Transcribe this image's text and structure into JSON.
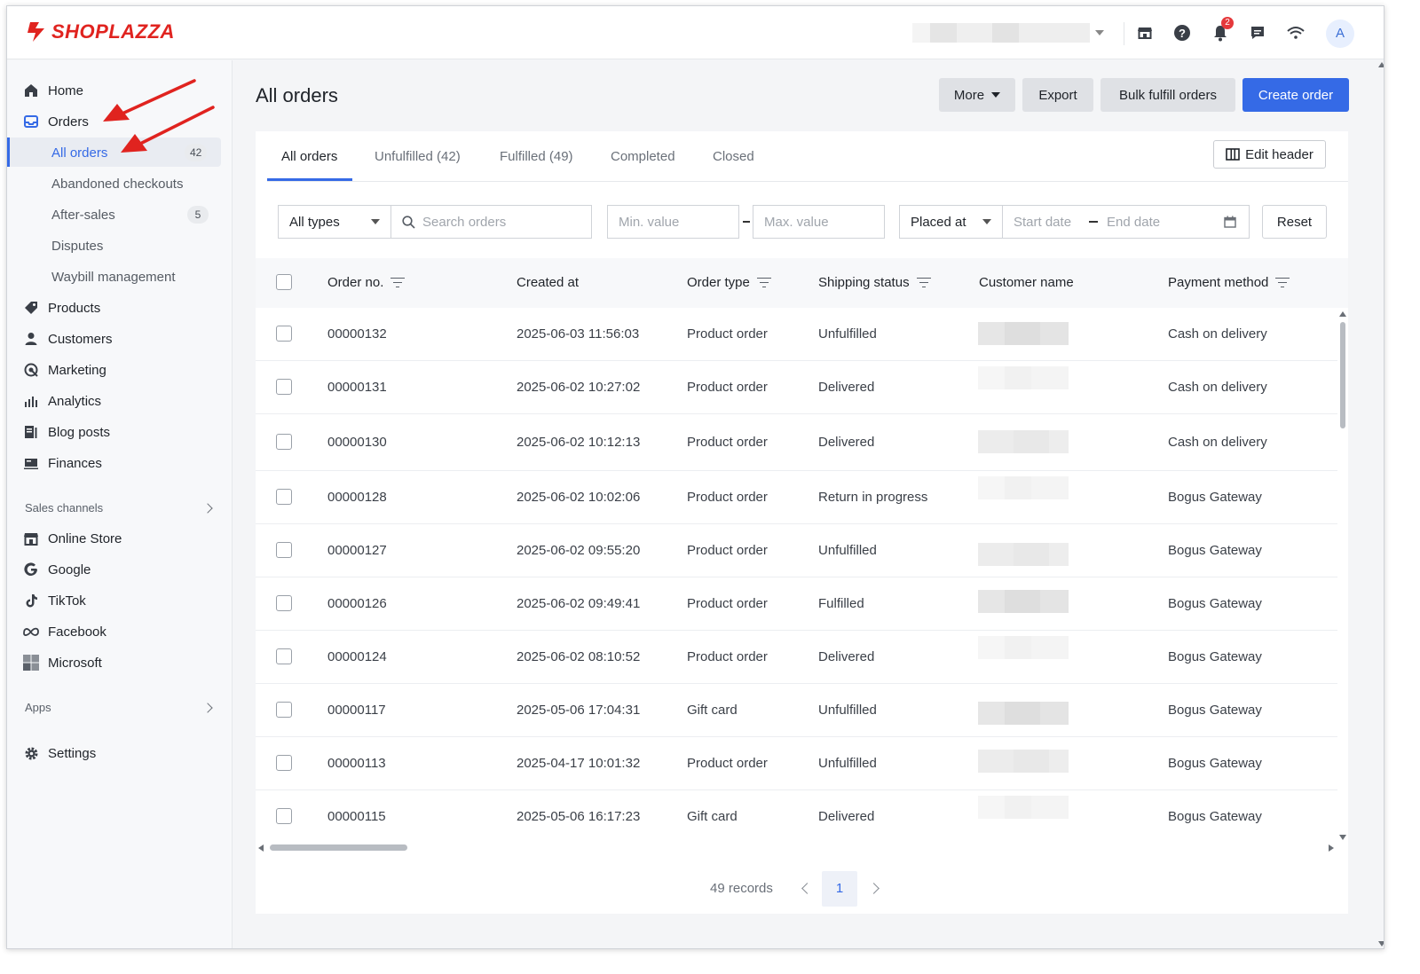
{
  "brand": {
    "name": "SHOPLAZZA",
    "color": "#e0231f"
  },
  "colors": {
    "accent": "#356ae6",
    "badge": "#e5383b"
  },
  "topbar": {
    "icons": [
      "store-icon",
      "help-icon",
      "bell-icon",
      "chat-icon",
      "wifi-icon"
    ],
    "notification_count": "2",
    "avatar_initial": "A"
  },
  "sidebar": {
    "items": [
      {
        "label": "Home",
        "icon": "home-icon"
      },
      {
        "label": "Orders",
        "icon": "orders-icon"
      },
      {
        "label": "Products",
        "icon": "tag-icon"
      },
      {
        "label": "Customers",
        "icon": "person-icon"
      },
      {
        "label": "Marketing",
        "icon": "marketing-icon"
      },
      {
        "label": "Analytics",
        "icon": "bar-chart-icon"
      },
      {
        "label": "Blog posts",
        "icon": "blog-icon"
      },
      {
        "label": "Finances",
        "icon": "finances-icon"
      }
    ],
    "order_subitems": [
      {
        "label": "All orders",
        "count": "42"
      },
      {
        "label": "Abandoned checkouts"
      },
      {
        "label": "After-sales",
        "count": "5"
      },
      {
        "label": "Disputes"
      },
      {
        "label": "Waybill management"
      }
    ],
    "sales_channels_label": "Sales channels",
    "channels": [
      {
        "label": "Online Store",
        "icon": "storefront-icon"
      },
      {
        "label": "Google",
        "icon": "google-icon"
      },
      {
        "label": "TikTok",
        "icon": "tiktok-icon"
      },
      {
        "label": "Facebook",
        "icon": "meta-icon"
      },
      {
        "label": "Microsoft",
        "icon": "microsoft-icon"
      }
    ],
    "apps_label": "Apps",
    "settings_label": "Settings"
  },
  "main": {
    "title": "All orders",
    "buttons": {
      "more": "More",
      "export": "Export",
      "bulk_fulfill": "Bulk fulfill orders",
      "create": "Create order"
    },
    "tabs": [
      "All orders",
      "Unfulfilled (42)",
      "Fulfilled (49)",
      "Completed",
      "Closed"
    ],
    "edit_header": "Edit header",
    "filters": {
      "type_value": "All types",
      "search_placeholder": "Search orders",
      "min_placeholder": "Min. value",
      "max_placeholder": "Max. value",
      "date_field": "Placed at",
      "start_placeholder": "Start date",
      "end_placeholder": "End date",
      "reset": "Reset"
    },
    "columns": [
      "Order no.",
      "Created at",
      "Order type",
      "Shipping status",
      "Customer name",
      "Payment method"
    ],
    "rows": [
      {
        "order_no": "00000132",
        "created_at": "2025-06-03 11:56:03",
        "order_type": "Product order",
        "shipping_status": "Unfulfilled",
        "payment_method": "Cash on delivery"
      },
      {
        "order_no": "00000131",
        "created_at": "2025-06-02 10:27:02",
        "order_type": "Product order",
        "shipping_status": "Delivered",
        "payment_method": "Cash on delivery"
      },
      {
        "order_no": "00000130",
        "created_at": "2025-06-02 10:12:13",
        "order_type": "Product order",
        "shipping_status": "Delivered",
        "payment_method": "Cash on delivery"
      },
      {
        "order_no": "00000128",
        "created_at": "2025-06-02 10:02:06",
        "order_type": "Product order",
        "shipping_status": "Return in progress",
        "payment_method": "Bogus Gateway"
      },
      {
        "order_no": "00000127",
        "created_at": "2025-06-02 09:55:20",
        "order_type": "Product order",
        "shipping_status": "Unfulfilled",
        "payment_method": "Bogus Gateway"
      },
      {
        "order_no": "00000126",
        "created_at": "2025-06-02 09:49:41",
        "order_type": "Product order",
        "shipping_status": "Fulfilled",
        "payment_method": "Bogus Gateway"
      },
      {
        "order_no": "00000124",
        "created_at": "2025-06-02 08:10:52",
        "order_type": "Product order",
        "shipping_status": "Delivered",
        "payment_method": "Bogus Gateway"
      },
      {
        "order_no": "00000117",
        "created_at": "2025-05-06 17:04:31",
        "order_type": "Gift card",
        "shipping_status": "Unfulfilled",
        "payment_method": "Bogus Gateway"
      },
      {
        "order_no": "00000113",
        "created_at": "2025-04-17 10:01:32",
        "order_type": "Product order",
        "shipping_status": "Unfulfilled",
        "payment_method": "Bogus Gateway"
      },
      {
        "order_no": "00000115",
        "created_at": "2025-05-06 16:17:23",
        "order_type": "Gift card",
        "shipping_status": "Delivered",
        "payment_method": "Bogus Gateway"
      }
    ],
    "pagination": {
      "records": "49 records",
      "current_page": "1"
    }
  }
}
